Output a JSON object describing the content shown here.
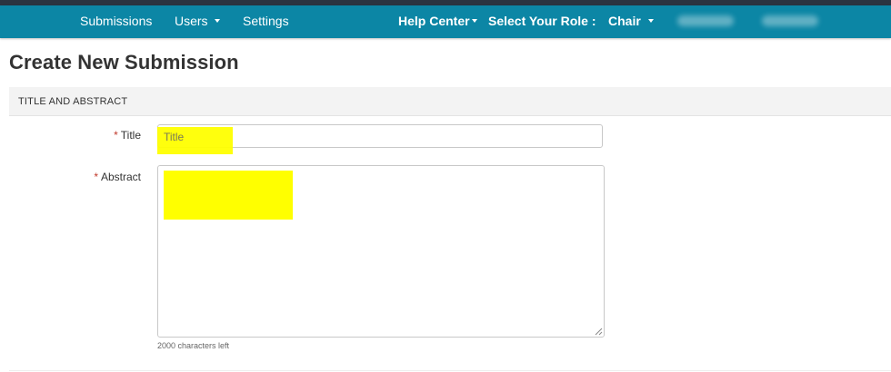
{
  "navbar": {
    "left_items": [
      {
        "label": "Submissions"
      },
      {
        "label": "Users",
        "has_caret": true
      },
      {
        "label": "Settings"
      }
    ],
    "help_center": "Help Center",
    "role_label": "Select Your Role :",
    "role_value": "Chair"
  },
  "page": {
    "title": "Create New Submission"
  },
  "section": {
    "header": "TITLE AND ABSTRACT"
  },
  "form": {
    "title_required_mark": "*",
    "title_label": "Title",
    "title_placeholder": "Title",
    "abstract_required_mark": "*",
    "abstract_label": "Abstract",
    "abstract_value": "",
    "chars_left": "2000 characters left"
  },
  "colors": {
    "navbar": "#0c86a5",
    "highlight": "#ffff00",
    "required": "#c0392b"
  }
}
